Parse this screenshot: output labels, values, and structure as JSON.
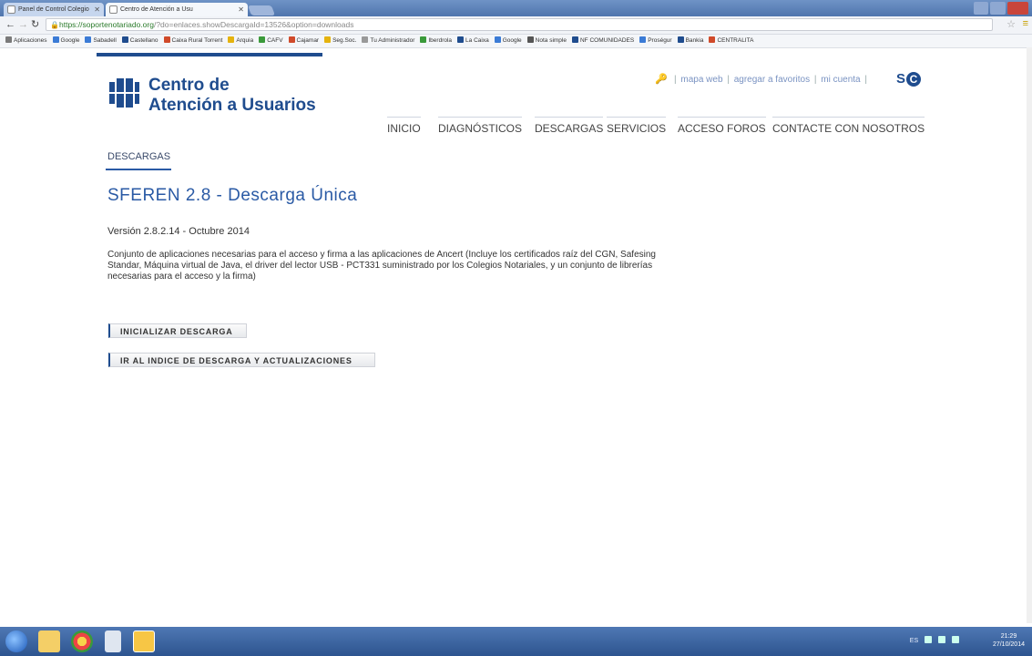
{
  "browser": {
    "tabs": [
      {
        "label": "Panel de Control Colegio"
      },
      {
        "label": "Centro de Atención a Usu"
      }
    ],
    "url_host": "https://soportenotariado.org",
    "url_rest": "/?do=enlaces.showDescargaId=13526&option=downloads",
    "bookmarks": [
      {
        "label": "Aplicaciones",
        "color": "#7a7a7a"
      },
      {
        "label": "Google",
        "color": "#3b7bd6"
      },
      {
        "label": "Sabadell",
        "color": "#3b7bd6"
      },
      {
        "label": "Castellano",
        "color": "#1f4c8e"
      },
      {
        "label": "Caixa Rural Torrent",
        "color": "#d04a2a"
      },
      {
        "label": "Arquia",
        "color": "#e5b30e"
      },
      {
        "label": "CAFV",
        "color": "#3a9a3a"
      },
      {
        "label": "Cajamar",
        "color": "#d04a2a"
      },
      {
        "label": "Seg.Soc.",
        "color": "#e5b30e"
      },
      {
        "label": "Tu Administrador",
        "color": "#999999"
      },
      {
        "label": "Iberdrola",
        "color": "#3a9a3a"
      },
      {
        "label": "La Caixa",
        "color": "#1f4c8e"
      },
      {
        "label": "Google",
        "color": "#3b7bd6"
      },
      {
        "label": "Nota simple",
        "color": "#555555"
      },
      {
        "label": "NF COMUNIDADES",
        "color": "#1f4c8e"
      },
      {
        "label": "Proségur",
        "color": "#3b7bd6"
      },
      {
        "label": "Bankia",
        "color": "#1f4c8e"
      },
      {
        "label": "CENTRALITA",
        "color": "#d04a2a"
      }
    ]
  },
  "header": {
    "logo_line1": "Centro de",
    "logo_line2": "Atención a Usuarios",
    "link_map": "mapa web",
    "link_fav": "agregar a favoritos",
    "link_account": "mi cuenta",
    "sep": "|",
    "brand": "S",
    "brand_circle": "C"
  },
  "nav": {
    "inicio": "INICIO",
    "diagnosticos": "DIAGNÓSTICOS",
    "descargas": "DESCARGAS",
    "servicios": "SERVICIOS",
    "foros": "ACCESO FOROS",
    "contacto": "CONTACTE CON NOSOTROS"
  },
  "main": {
    "breadcrumb": "DESCARGAS",
    "title": "SFEREN 2.8 - Descarga Única",
    "version": "Versión 2.8.2.14 - Octubre 2014",
    "description": "Conjunto de aplicaciones necesarias para el acceso y firma a las aplicaciones de Ancert (Incluye los certificados raíz del CGN, Safesing Standar, Máquina virtual de Java, el driver del lector USB - PCT331 suministrado por los Colegios Notariales, y un conjunto de librerías necesarias para el acceso y la firma)",
    "btn_download": "INICIALIZAR DESCARGA",
    "btn_index": "IR AL INDICE DE DESCARGA Y ACTUALIZACIONES"
  },
  "taskbar": {
    "lang": "ES",
    "time": "21:29",
    "date": "27/10/2014"
  },
  "colors": {
    "brand_blue": "#1f4c8e",
    "title_blue": "#2a5aa5"
  }
}
